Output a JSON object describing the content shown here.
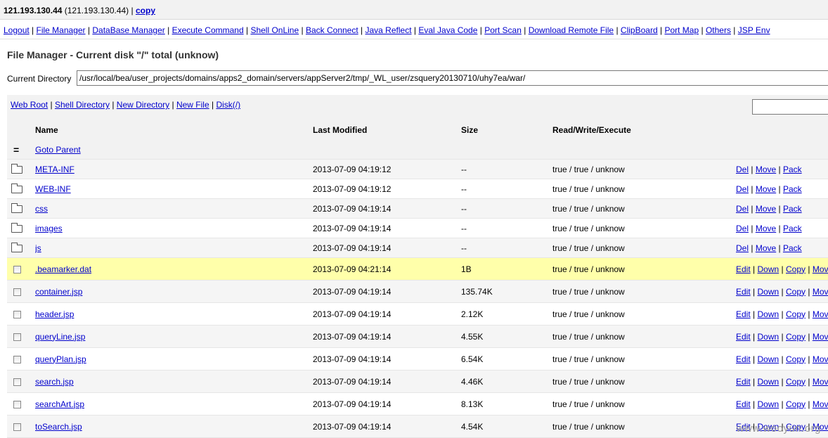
{
  "topbar": {
    "host": "121.193.130.44",
    "host_paren": "(121.193.130.44)",
    "separator": "|",
    "copy_link": "copy"
  },
  "nav": {
    "items": [
      "Logout",
      "File Manager",
      "DataBase Manager",
      "Execute Command",
      "Shell OnLine",
      "Back Connect",
      "Java Reflect",
      "Eval Java Code",
      "Port Scan",
      "Download Remote File",
      "ClipBoard",
      "Port Map",
      "Others",
      "JSP Env"
    ]
  },
  "page": {
    "title": "File Manager - Current disk \"/\" total (unknow)",
    "current_dir_label": "Current Directory",
    "current_dir_value": "/usr/local/bea/user_projects/domains/apps2_domain/servers/appServer2/tmp/_WL_user/zsquery20130710/uhy7ea/war/"
  },
  "shortcuts": {
    "items": [
      "Web Root",
      "Shell Directory",
      "New Directory",
      "New File",
      "Disk(/)"
    ],
    "filter_value": ""
  },
  "table": {
    "headers": {
      "name": "Name",
      "modified": "Last Modified",
      "size": "Size",
      "perm": "Read/Write/Execute"
    },
    "parent": {
      "icon": "=",
      "label": "Goto Parent"
    },
    "dir_actions": [
      "Del",
      "Move",
      "Pack"
    ],
    "file_actions": [
      "Edit",
      "Down",
      "Copy",
      "Move"
    ],
    "directories": [
      {
        "name": "META-INF",
        "modified": "2013-07-09 04:19:12",
        "size": "--",
        "perm": "true / true / unknow"
      },
      {
        "name": "WEB-INF",
        "modified": "2013-07-09 04:19:12",
        "size": "--",
        "perm": "true / true / unknow"
      },
      {
        "name": "css",
        "modified": "2013-07-09 04:19:14",
        "size": "--",
        "perm": "true / true / unknow"
      },
      {
        "name": "images",
        "modified": "2013-07-09 04:19:14",
        "size": "--",
        "perm": "true / true / unknow"
      },
      {
        "name": "js",
        "modified": "2013-07-09 04:19:14",
        "size": "--",
        "perm": "true / true / unknow"
      }
    ],
    "files": [
      {
        "name": ".beamarker.dat",
        "modified": "2013-07-09 04:21:14",
        "size": "1B",
        "perm": "true / true / unknow",
        "highlight": true
      },
      {
        "name": "container.jsp",
        "modified": "2013-07-09 04:19:14",
        "size": "135.74K",
        "perm": "true / true / unknow"
      },
      {
        "name": "header.jsp",
        "modified": "2013-07-09 04:19:14",
        "size": "2.12K",
        "perm": "true / true / unknow"
      },
      {
        "name": "queryLine.jsp",
        "modified": "2013-07-09 04:19:14",
        "size": "4.55K",
        "perm": "true / true / unknow"
      },
      {
        "name": "queryPlan.jsp",
        "modified": "2013-07-09 04:19:14",
        "size": "6.54K",
        "perm": "true / true / unknow"
      },
      {
        "name": "search.jsp",
        "modified": "2013-07-09 04:19:14",
        "size": "4.46K",
        "perm": "true / true / unknow"
      },
      {
        "name": "searchArt.jsp",
        "modified": "2013-07-09 04:19:14",
        "size": "8.13K",
        "perm": "true / true / unknow"
      },
      {
        "name": "toSearch.jsp",
        "modified": "2013-07-09 04:19:14",
        "size": "4.54K",
        "perm": "true / true / unknow"
      }
    ]
  },
  "watermark": "www.wooyun.org",
  "colors": {
    "link": "#0000cc",
    "highlight_row": "#ffffaa",
    "header_bg": "#f2f2f2"
  }
}
